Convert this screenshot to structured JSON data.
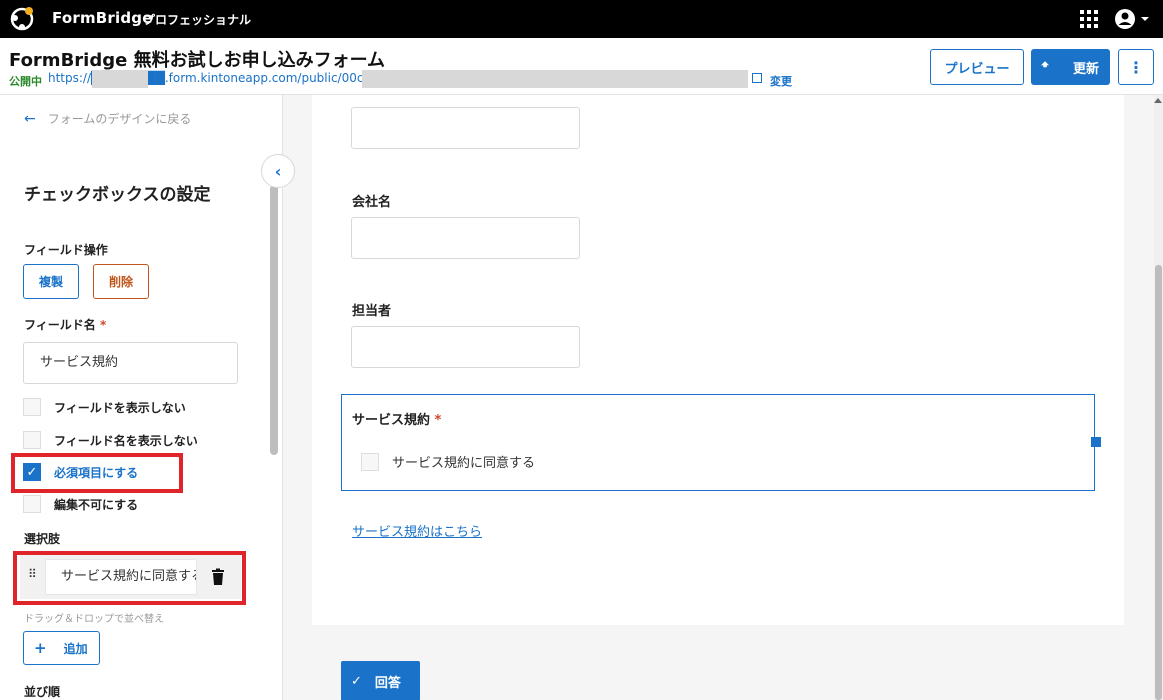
{
  "topbar": {
    "brand": "FormBridge",
    "edition": "プロフェッショナル"
  },
  "header": {
    "title": "FormBridge 無料お試しお申し込みフォーム",
    "status": "公開中",
    "url": "https://████████.form.kintoneapp.com/public/00c216█████████████████████████████████████e",
    "change_label": "変更",
    "preview_label": "プレビュー",
    "update_label": "更新"
  },
  "left_panel": {
    "back_label": "フォームのデザインに戻る",
    "heading": "チェックボックスの設定",
    "field_ops_label": "フィールド操作",
    "duplicate_label": "複製",
    "delete_label": "削除",
    "field_name_label": "フィールド名",
    "required_star": "*",
    "field_name_value": "サービス規約",
    "checkboxes": [
      {
        "label": "フィールドを表示しない",
        "checked": false
      },
      {
        "label": "フィールド名を表示しない",
        "checked": false
      },
      {
        "label": "必須項目にする",
        "checked": true
      },
      {
        "label": "編集不可にする",
        "checked": false
      }
    ],
    "options_label": "選択肢",
    "option_value": "サービス規約に同意する",
    "drag_hint": "ドラッグ＆ドロップで並べ替え",
    "add_label": "追加",
    "sort_label": "並び順"
  },
  "form": {
    "company_label": "会社名",
    "person_label": "担当者",
    "terms_field_title": "サービス規約",
    "terms_required_star": "*",
    "terms_option": "サービス規約に同意する",
    "terms_link": "サービス規約はこちら",
    "submit_label": "回答"
  },
  "colors": {
    "accent": "#1a73c8",
    "danger": "#c0561b",
    "highlight": "#e0252a",
    "status_green": "#2a8a2a"
  }
}
